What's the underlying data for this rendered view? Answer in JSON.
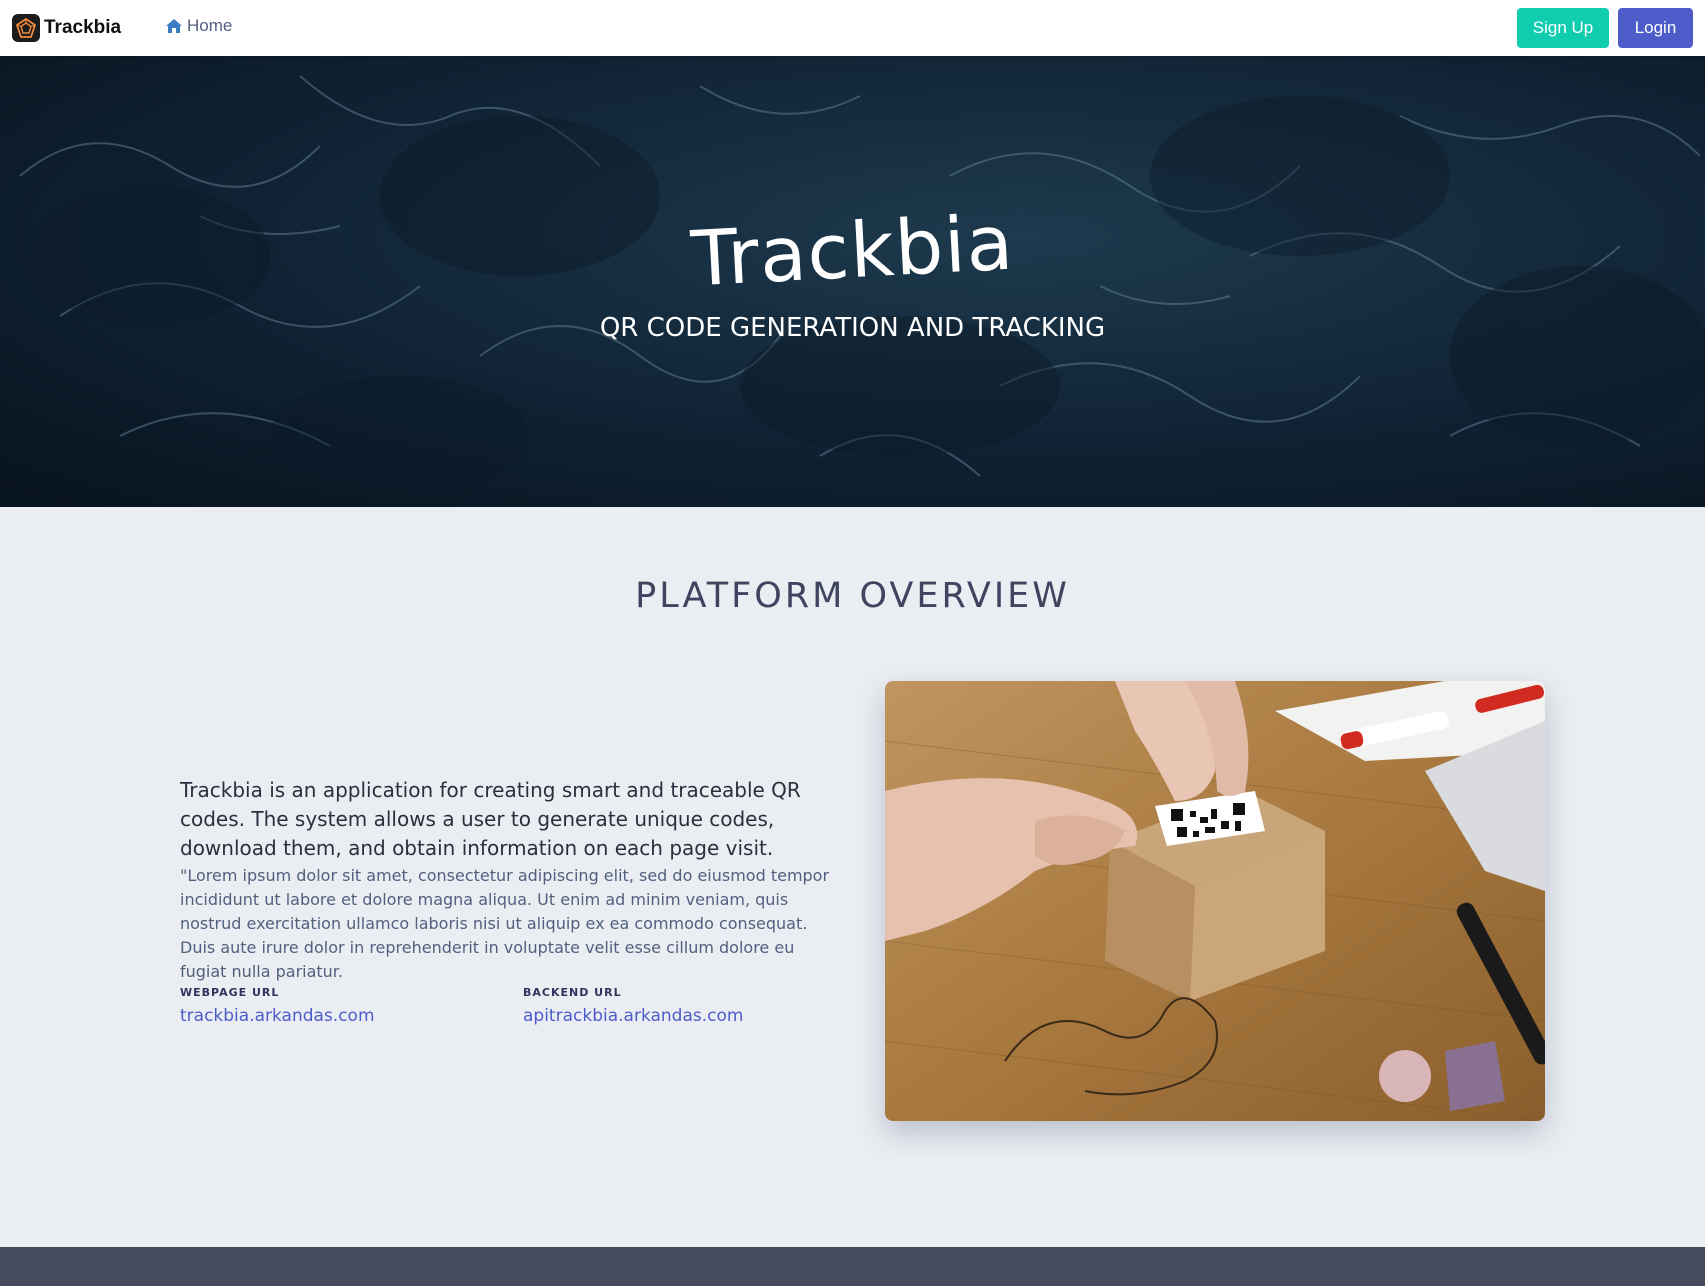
{
  "navbar": {
    "brand": "Trackbia",
    "home_label": "Home",
    "signup_label": "Sign Up",
    "login_label": "Login"
  },
  "hero": {
    "title": "Trackbia",
    "subtitle": "QR CODE GENERATION AND TRACKING"
  },
  "overview": {
    "title": "PLATFORM OVERVIEW",
    "lead": "Trackbia is an application for creating smart and traceable QR codes. The system allows a user to generate unique codes, download them, and obtain information on each page visit.",
    "description": "\"Lorem ipsum dolor sit amet, consectetur adipiscing elit, sed do eiusmod tempor incididunt ut labore et dolore magna aliqua. Ut enim ad minim veniam, quis nostrud exercitation ullamco laboris nisi ut aliquip ex ea commodo consequat. Duis aute irure dolor in reprehenderit in voluptate velit esse cillum dolore eu fugiat nulla pariatur.",
    "webpage_label": "WEBPAGE URL",
    "webpage_url": "trackbia.arkandas.com",
    "backend_label": "BACKEND URL",
    "backend_url": "apitrackbia.arkandas.com"
  },
  "colors": {
    "signup": "#11cdb0",
    "login": "#4e5cc9",
    "link": "#4e5cc9",
    "background": "#eaeef2",
    "footer": "#454b5d"
  },
  "icons": [
    "trackbia-logo-icon",
    "home-icon"
  ]
}
